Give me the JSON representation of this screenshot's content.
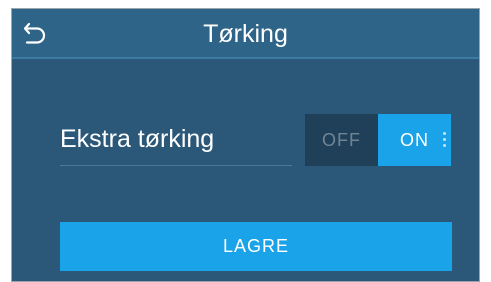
{
  "header": {
    "title": "Tørking",
    "back_icon": "back-arrow-icon"
  },
  "setting": {
    "label": "Ekstra tørking",
    "toggle": {
      "off_label": "OFF",
      "on_label": "ON",
      "selected": "ON"
    }
  },
  "actions": {
    "save_label": "LAGRE"
  },
  "colors": {
    "background": "#2b5878",
    "header": "#2d6488",
    "accent": "#1aa3e8",
    "toggle_inactive": "#1f4058"
  }
}
